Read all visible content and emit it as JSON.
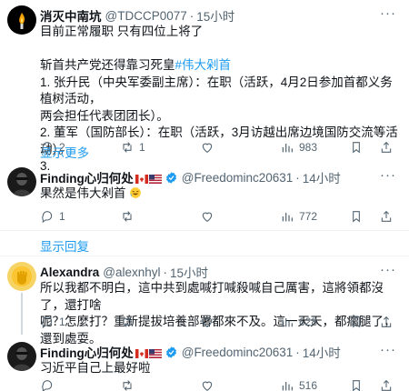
{
  "tweets": [
    {
      "author": "消灭中南坑",
      "handle": "@TDCCP0077",
      "time": "15小时",
      "lines": [
        "目前正常履职 只有四位上将了",
        "",
        "斩首共产党还得靠习死皇",
        "1. 张升民（中央军委副主席）：在职（活跃，4月2日参加首都义务植树活动，",
        "两会担任代表团团长）。",
        "2. 董军（国防部长）：在职（活跃，3月访越出席边境国防交流等活动）。",
        "3."
      ],
      "hashtag": "#伟大剁首",
      "show_more": "显示更多",
      "replies": "2",
      "retweets": "1",
      "likes": "",
      "views": "983"
    },
    {
      "author": "Finding心归何处",
      "handle": "@Freedominc20631",
      "time": "14小时",
      "text": "果然是伟大剁首",
      "replies": "1",
      "retweets": "",
      "likes": "",
      "views": "772",
      "show_reply": "显示回复"
    },
    {
      "author": "Alexandra",
      "handle": "@alexnhyl",
      "time": "15小时",
      "lines": [
        "所以我都不明白，這中共到處喊打喊殺喊自己厲害，這將領都沒了，還打啥",
        "呢？怎麼打？重新提拔培養部署都來不及。這一天天，都瘸腿了，還到處耍。"
      ],
      "replies": "1",
      "retweets": "",
      "likes": "",
      "views": "628"
    },
    {
      "author": "Finding心归何处",
      "handle": "@Freedominc20631",
      "time": "14小时",
      "text": "习近平自己上最好啦",
      "replies": "",
      "retweets": "",
      "likes": "",
      "views": "516"
    }
  ],
  "colors": {
    "accent": "#1d9bf0",
    "muted": "#536471",
    "text": "#0f1419"
  },
  "icons": [
    "more-icon",
    "verified-icon",
    "reply-icon",
    "retweet-icon",
    "like-icon",
    "views-icon",
    "bookmark-icon",
    "share-icon"
  ]
}
